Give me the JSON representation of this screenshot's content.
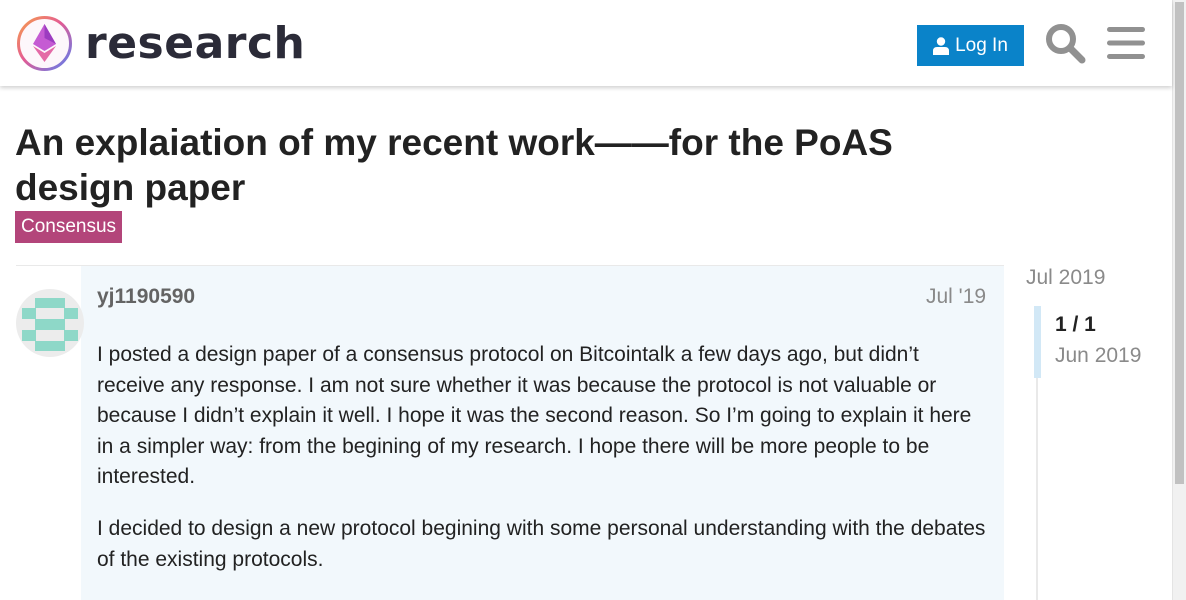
{
  "site": {
    "logo_text": "research",
    "logo_icon": "ethereum-research-logo"
  },
  "header": {
    "login_label": "Log In",
    "search_icon": "search-icon",
    "menu_icon": "hamburger-menu-icon"
  },
  "topic": {
    "title": "An explaiation of my recent work——for the PoAS design paper",
    "category": "Consensus",
    "category_color": "#b3457a"
  },
  "post": {
    "username": "yj1190590",
    "date": "Jul '19",
    "paragraphs": [
      "I posted a design paper of a consensus protocol on Bitcointalk a few days ago, but didn’t receive any response. I am not sure whether it was because the protocol is not valuable or because I didn’t explain it well. I hope it was the second reason. So I’m going to explain it here in a simpler way: from the begining of my research. I hope there will be more people to be interested.",
      "I decided to design a new protocol begining with some personal understanding with the debates of the existing protocols."
    ]
  },
  "timeline": {
    "start_date": "Jul 2019",
    "position": "1 / 1",
    "end_date": "Jun 2019"
  },
  "colors": {
    "accent": "#0a83c9",
    "post_background": "#f2f8fc"
  }
}
